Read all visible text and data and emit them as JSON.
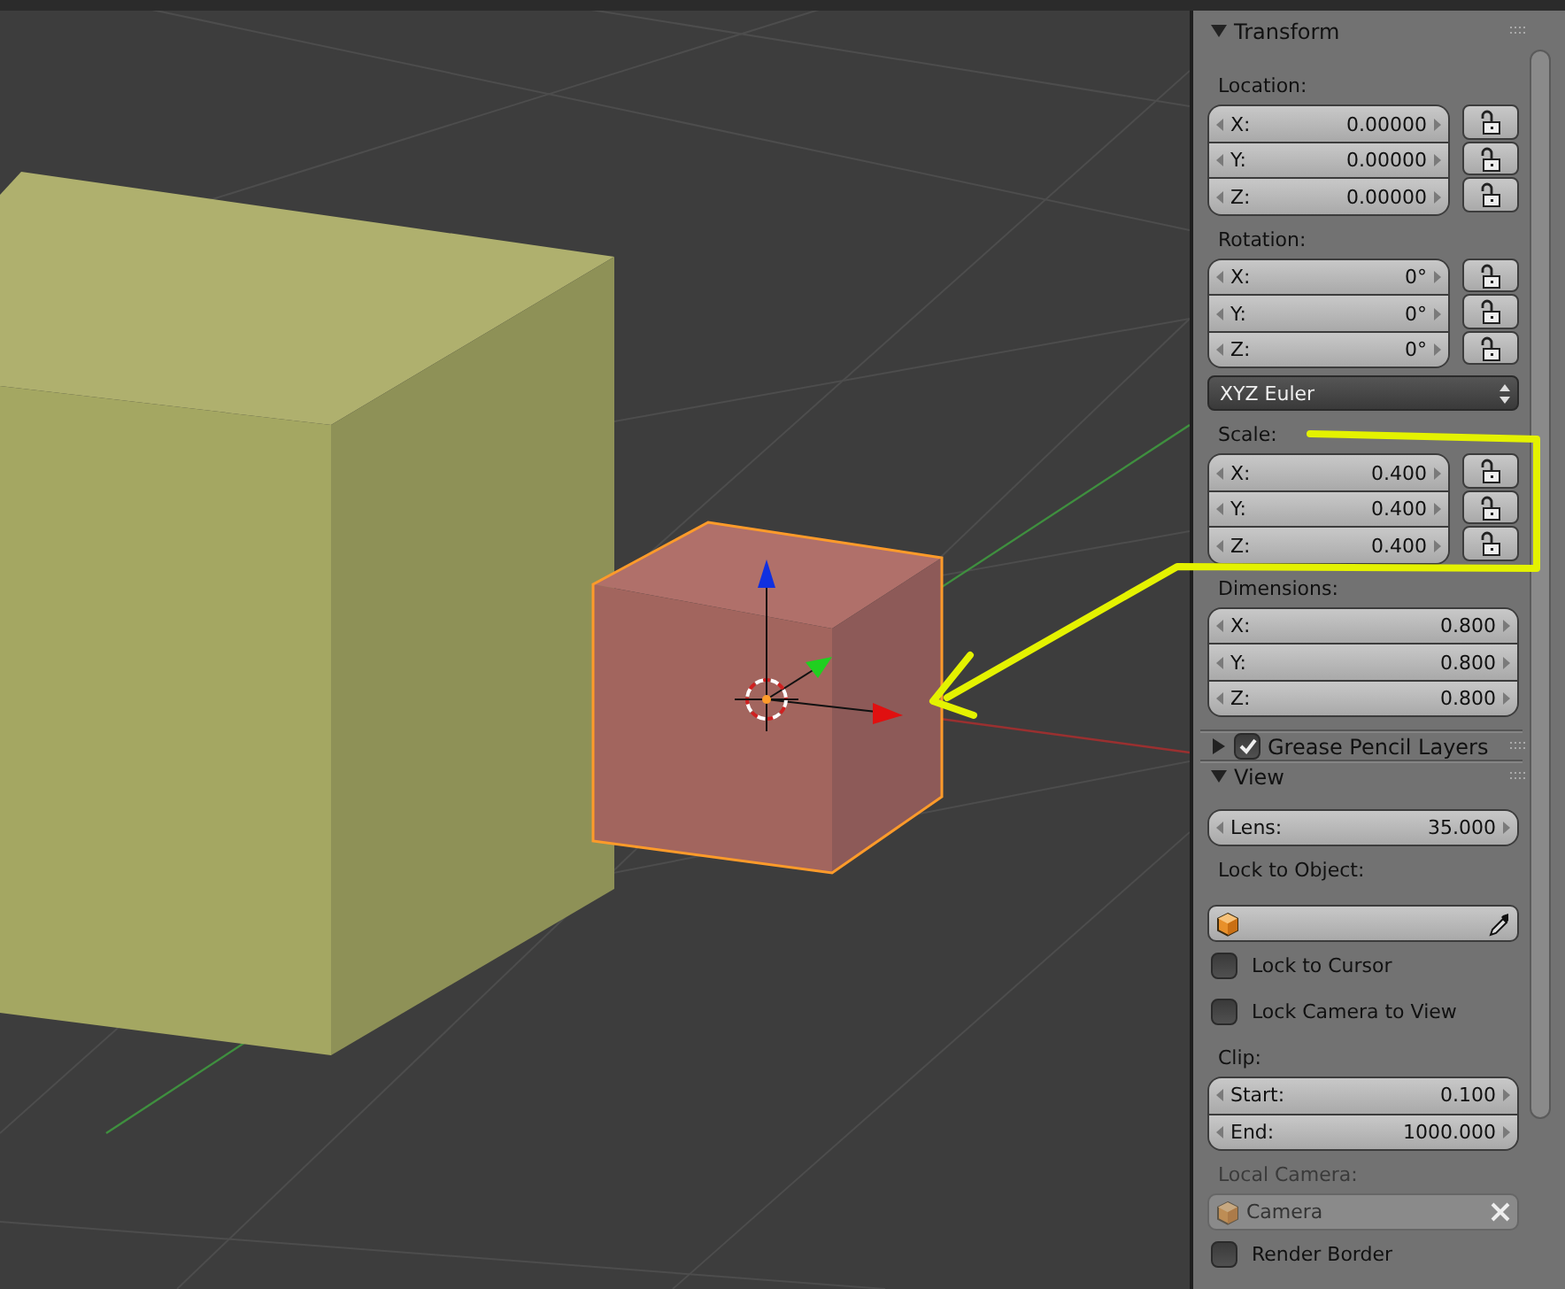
{
  "sidebar": {
    "panels": [
      {
        "title": "Transform",
        "expanded": true,
        "items": [
          {
            "kind": "label",
            "text": "Location:"
          },
          {
            "kind": "fields",
            "locks": true,
            "rows": [
              {
                "label": "X:",
                "value": "0.00000",
                "locked": false
              },
              {
                "label": "Y:",
                "value": "0.00000",
                "locked": false
              },
              {
                "label": "Z:",
                "value": "0.00000",
                "locked": false
              }
            ]
          },
          {
            "kind": "label",
            "text": "Rotation:"
          },
          {
            "kind": "fields",
            "locks": true,
            "rows": [
              {
                "label": "X:",
                "value": "0°",
                "locked": false
              },
              {
                "label": "Y:",
                "value": "0°",
                "locked": false
              },
              {
                "label": "Z:",
                "value": "0°",
                "locked": false
              }
            ]
          },
          {
            "kind": "dropdown",
            "text": "XYZ Euler"
          },
          {
            "kind": "label",
            "text": "Scale:"
          },
          {
            "kind": "fields",
            "locks": true,
            "rows": [
              {
                "label": "X:",
                "value": "0.400",
                "locked": false
              },
              {
                "label": "Y:",
                "value": "0.400",
                "locked": false
              },
              {
                "label": "Z:",
                "value": "0.400",
                "locked": false
              }
            ]
          },
          {
            "kind": "label",
            "text": "Dimensions:"
          },
          {
            "kind": "fields",
            "locks": false,
            "rows": [
              {
                "label": "X:",
                "value": "0.800"
              },
              {
                "label": "Y:",
                "value": "0.800"
              },
              {
                "label": "Z:",
                "value": "0.800"
              }
            ]
          }
        ]
      },
      {
        "title": "Grease Pencil Layers",
        "expanded": false,
        "checked": true
      },
      {
        "title": "View",
        "expanded": true,
        "items": [
          {
            "kind": "fields",
            "locks": false,
            "rows": [
              {
                "label": "Lens:",
                "value": "35.000"
              }
            ]
          },
          {
            "kind": "label",
            "text": "Lock to Object:"
          },
          {
            "kind": "object_field",
            "disabled": false
          },
          {
            "kind": "checkbox",
            "text": "Lock to Cursor",
            "checked": false
          },
          {
            "kind": "checkbox",
            "text": "Lock Camera to View",
            "checked": false
          },
          {
            "kind": "label",
            "text": "Clip:"
          },
          {
            "kind": "fields",
            "locks": false,
            "rows": [
              {
                "label": "Start:",
                "value": "0.100"
              },
              {
                "label": "End:",
                "value": "1000.000"
              }
            ]
          },
          {
            "kind": "label",
            "text": "Local Camera:",
            "disabled": true
          },
          {
            "kind": "object_field",
            "value": "Camera",
            "disabled": true
          },
          {
            "kind": "checkbox",
            "text": "Render Border",
            "checked": false
          }
        ]
      }
    ]
  }
}
